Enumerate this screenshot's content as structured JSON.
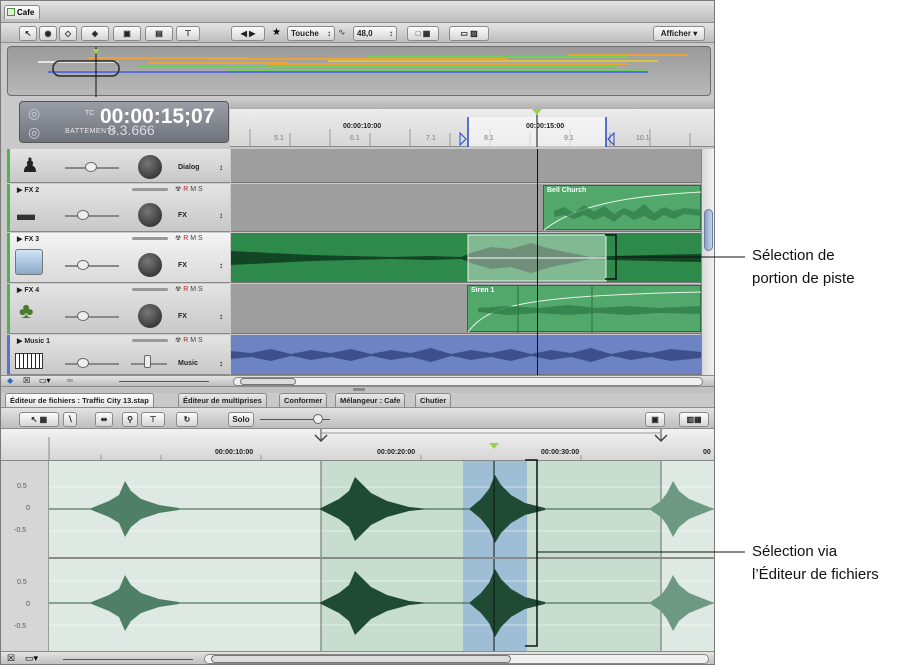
{
  "project": {
    "tab_label": "Cafe"
  },
  "toolbar": {
    "scrub_mode": "Touche",
    "zoom_value": "48,0",
    "view_menu": "Afficher"
  },
  "timecode": {
    "prefix": "TC",
    "value": "00:00:15;07",
    "beats_label": "BATTEMENTS",
    "beats_value": "8.3.666"
  },
  "ruler": {
    "timecodes": [
      "00:00:10:00",
      "00:00:15:00"
    ],
    "beats": [
      "5.1",
      "6.1",
      "7.1",
      "8.1",
      "9.1",
      "10.1"
    ]
  },
  "tracks": [
    {
      "name": "",
      "role": "Dialog",
      "icon": "person-icon"
    },
    {
      "name": "FX 2",
      "role": "FX",
      "icon": "shoe-icon",
      "clip": "Bell Church"
    },
    {
      "name": "FX 3",
      "role": "FX",
      "icon": "car-icon"
    },
    {
      "name": "FX 4",
      "role": "FX",
      "icon": "tree-icon",
      "clip": "Siren 1"
    },
    {
      "name": "Music 1",
      "role": "Music",
      "icon": "keyboard-icon"
    }
  ],
  "track_buttons": {
    "r": "R",
    "m": "M",
    "s": "S"
  },
  "editor_tabs": [
    "Éditeur de fichiers : Traffic City 13.stap",
    "Éditeur de multiprises",
    "Conformer",
    "Mélangeur : Cafe",
    "Chutier"
  ],
  "file_editor": {
    "solo_label": "Solo",
    "timecodes": [
      "00:00:10:00",
      "00:00:20:00",
      "00:00:30:00",
      "00"
    ],
    "amp_labels": [
      "0.5",
      "0",
      "-0.5"
    ]
  },
  "callouts": {
    "track_selection_line1": "Sélection de",
    "track_selection_line2": "portion de piste",
    "file_selection_line1": "Sélection via",
    "file_selection_line2": "l’Éditeur de fichiers"
  },
  "colors": {
    "clip_green": "#52a86a",
    "music_blue": "#6d84c4",
    "selection_blue": "#8fb3d6"
  }
}
